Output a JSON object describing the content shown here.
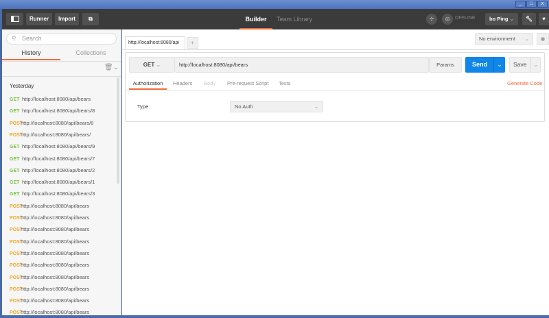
{
  "window": {
    "minimize": "_",
    "maximize": "□",
    "close": "x"
  },
  "header": {
    "runner": "Runner",
    "import": "Import",
    "tabs": [
      "Builder",
      "Team Library"
    ],
    "status": "OFFLINE",
    "user": "bo Ping"
  },
  "sidebar": {
    "search_placeholder": "Search",
    "tabs": [
      "History",
      "Collections"
    ],
    "group": "Yesterday",
    "items": [
      {
        "method": "GET",
        "url": "http://localhost:8080/api/bears"
      },
      {
        "method": "GET",
        "url": "http://localhost:8080/api/bears/8"
      },
      {
        "method": "POST",
        "url": "http://localhost:8080/api/bears/8"
      },
      {
        "method": "POST",
        "url": "http://localhost:8080/api/bears/"
      },
      {
        "method": "GET",
        "url": "http://localhost:8080/api/bears/9"
      },
      {
        "method": "GET",
        "url": "http://localhost:8080/api/bears/7"
      },
      {
        "method": "GET",
        "url": "http://localhost:8080/api/bears/2"
      },
      {
        "method": "GET",
        "url": "http://localhost:8080/api/bears/1"
      },
      {
        "method": "GET",
        "url": "http://localhost:8080/api/bears/3"
      },
      {
        "method": "POST",
        "url": "http://localhost:8080/api/bears"
      },
      {
        "method": "POST",
        "url": "http://localhost:8080/api/bears"
      },
      {
        "method": "POST",
        "url": "http://localhost:8080/api/bears"
      },
      {
        "method": "POST",
        "url": "http://localhost:8080/api/bears"
      },
      {
        "method": "POST",
        "url": "http://localhost:8080/api/bears"
      },
      {
        "method": "POST",
        "url": "http://localhost:8080/api/bears"
      },
      {
        "method": "POST",
        "url": "http://localhost:8080/api/bears"
      },
      {
        "method": "POST",
        "url": "http://localhost:8080/api/bears"
      },
      {
        "method": "POST",
        "url": "http://localhost:8080/api/bears"
      },
      {
        "method": "POST",
        "url": "http://localhost:8080/api/bears"
      }
    ]
  },
  "main": {
    "tab": "http://localhost:8080/api",
    "add_tab": "+",
    "environment": "No environment",
    "method": "GET",
    "url": "http://localhost:8080/api/bears",
    "params": "Params",
    "send": "Send",
    "save": "Save",
    "request_tabs": [
      "Authorization",
      "Headers",
      "Body",
      "Pre-request Script",
      "Tests"
    ],
    "generate_code": "Generate Code",
    "auth_label": "Type",
    "auth_value": "No Auth"
  }
}
